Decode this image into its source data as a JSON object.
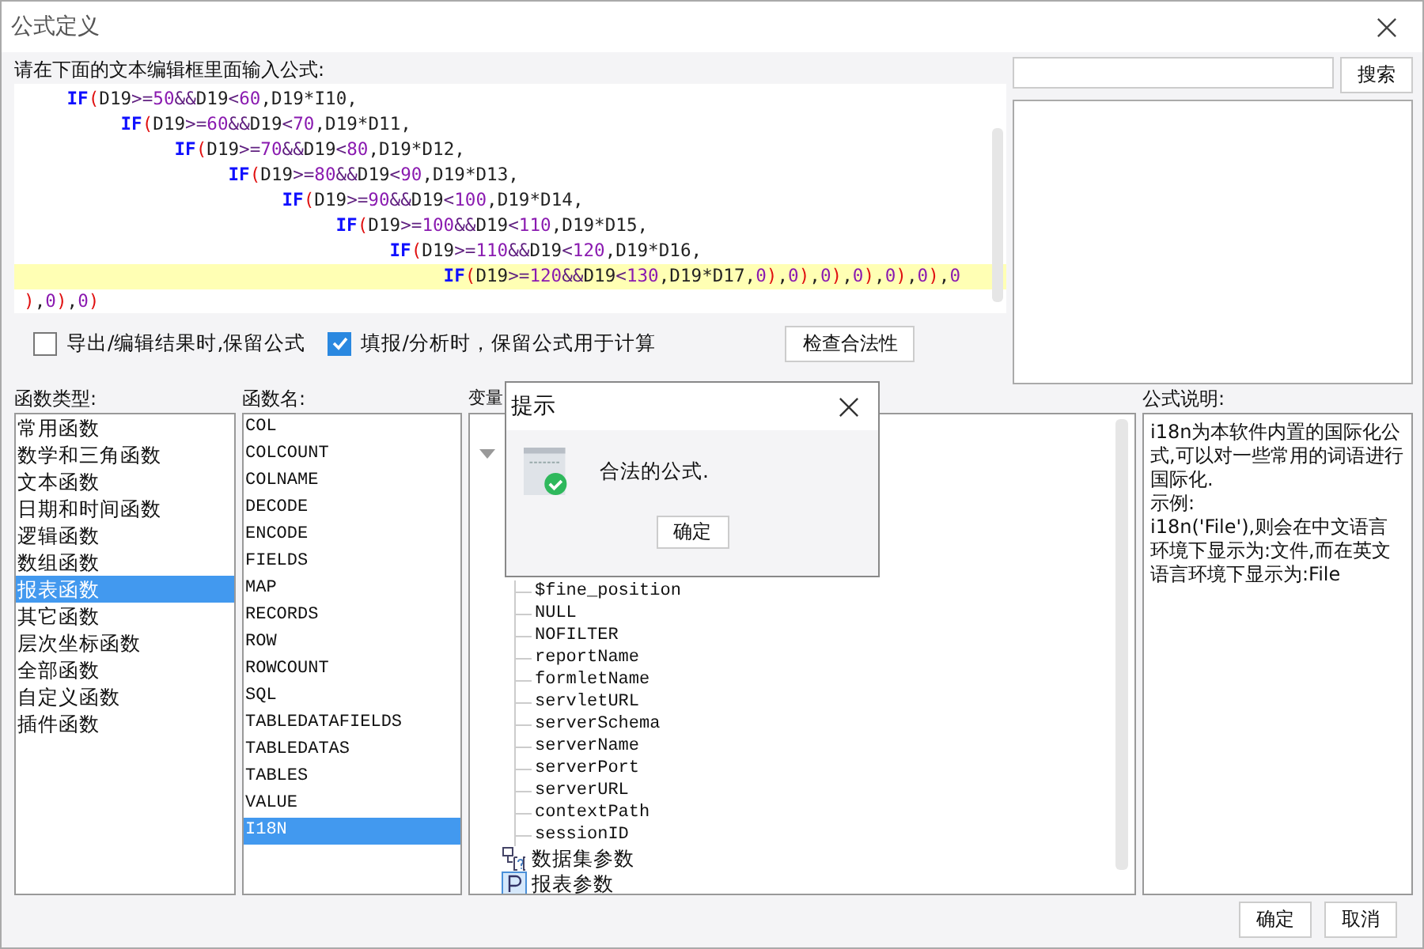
{
  "window": {
    "title": "公式定义"
  },
  "editor": {
    "label": "请在下面的文本编辑框里面输入公式:",
    "lines": [
      {
        "text": "    IF(D19>=50&&D19<60,D19*I10,",
        "highlighted": false
      },
      {
        "text": "         IF(D19>=60&&D19<70,D19*D11,",
        "highlighted": false
      },
      {
        "text": "              IF(D19>=70&&D19<80,D19*D12,",
        "highlighted": false
      },
      {
        "text": "                   IF(D19>=80&&D19<90,D19*D13,",
        "highlighted": false
      },
      {
        "text": "                        IF(D19>=90&&D19<100,D19*D14,",
        "highlighted": false
      },
      {
        "text": "                             IF(D19>=100&&D19<110,D19*D15,",
        "highlighted": false
      },
      {
        "text": "                                  IF(D19>=110&&D19<120,D19*D16,",
        "highlighted": false
      },
      {
        "text": "                                       IF(D19>=120&&D19<130,D19*D17,0),0),0),0),0),0),0",
        "highlighted": true
      },
      {
        "text": "),0),0)",
        "highlighted": false
      }
    ]
  },
  "search": {
    "button": "搜索"
  },
  "options": [
    {
      "label": "导出/编辑结果时,保留公式",
      "checked": false
    },
    {
      "label": "填报/分析时，保留公式用于计算",
      "checked": true
    }
  ],
  "check_button": "检查合法性",
  "function_types": {
    "label": "函数类型:",
    "items": [
      {
        "label": "常用函数",
        "selected": false
      },
      {
        "label": "数学和三角函数",
        "selected": false
      },
      {
        "label": "文本函数",
        "selected": false
      },
      {
        "label": "日期和时间函数",
        "selected": false
      },
      {
        "label": "逻辑函数",
        "selected": false
      },
      {
        "label": "数组函数",
        "selected": false
      },
      {
        "label": "报表函数",
        "selected": true
      },
      {
        "label": "其它函数",
        "selected": false
      },
      {
        "label": "层次坐标函数",
        "selected": false
      },
      {
        "label": "全部函数",
        "selected": false
      },
      {
        "label": "自定义函数",
        "selected": false
      },
      {
        "label": "插件函数",
        "selected": false
      }
    ]
  },
  "function_names": {
    "label": "函数名:",
    "items": [
      {
        "label": "COL",
        "selected": false
      },
      {
        "label": "COLCOUNT",
        "selected": false
      },
      {
        "label": "COLNAME",
        "selected": false
      },
      {
        "label": "DECODE",
        "selected": false
      },
      {
        "label": "ENCODE",
        "selected": false
      },
      {
        "label": "FIELDS",
        "selected": false
      },
      {
        "label": "MAP",
        "selected": false
      },
      {
        "label": "RECORDS",
        "selected": false
      },
      {
        "label": "ROW",
        "selected": false
      },
      {
        "label": "ROWCOUNT",
        "selected": false
      },
      {
        "label": "SQL",
        "selected": false
      },
      {
        "label": "TABLEDATAFIELDS",
        "selected": false
      },
      {
        "label": "TABLEDATAS",
        "selected": false
      },
      {
        "label": "TABLES",
        "selected": false
      },
      {
        "label": "VALUE",
        "selected": false
      },
      {
        "label": "I18N",
        "selected": true
      }
    ]
  },
  "variables": {
    "label": "变量",
    "tree": [
      {
        "label": "$fine_position"
      },
      {
        "label": "NULL"
      },
      {
        "label": "NOFILTER"
      },
      {
        "label": "reportName"
      },
      {
        "label": "formletName"
      },
      {
        "label": "servletURL"
      },
      {
        "label": "serverSchema"
      },
      {
        "label": "serverName"
      },
      {
        "label": "serverPort"
      },
      {
        "label": "serverURL"
      },
      {
        "label": "contextPath"
      },
      {
        "label": "sessionID"
      }
    ],
    "groups": [
      {
        "label": "数据集参数",
        "kind": "dataset"
      },
      {
        "label": "报表参数",
        "kind": "param"
      }
    ]
  },
  "description": {
    "label": "公式说明:",
    "paragraphs": [
      "i18n为本软件内置的国际化公式,可以对一些常用的词语进行国际化.",
      "示例:",
      "i18n('File'),则会在中文语言环境下显示为:文件,而在英文语言环境下显示为:File"
    ]
  },
  "buttons": [
    "确定",
    "取消"
  ],
  "dialog": {
    "title": "提示",
    "message": "合法的公式.",
    "button": "确定"
  }
}
